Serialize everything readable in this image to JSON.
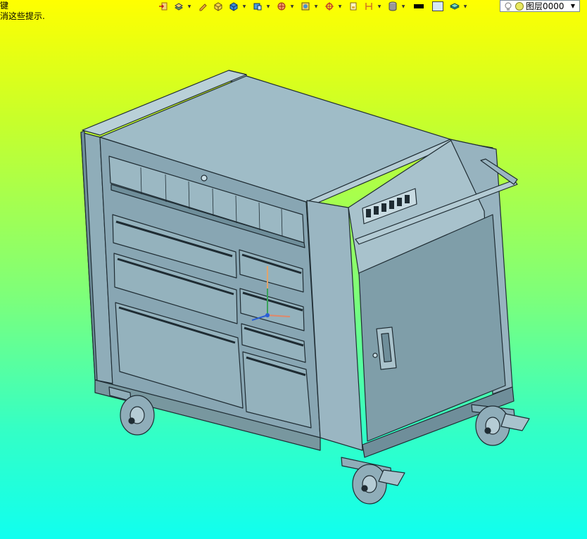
{
  "hints": {
    "line1": "键",
    "line2": "消这些提示."
  },
  "toolbar": {
    "icons": [
      "import-icon",
      "layer-tool-icon",
      "pen-icon",
      "box-yellow-icon",
      "solid-icon",
      "view-cube-icon",
      "target-icon",
      "frame-icon",
      "snap-icon",
      "page-icon",
      "measure-icon",
      "cylinder-icon"
    ],
    "color_swatch": "#000000",
    "fill_swatch": "#d6e8f6",
    "layer_label": "图层0000"
  },
  "scene": {
    "cabinet_color": "#8fb0bd",
    "edge_color": "#1f2c33"
  }
}
